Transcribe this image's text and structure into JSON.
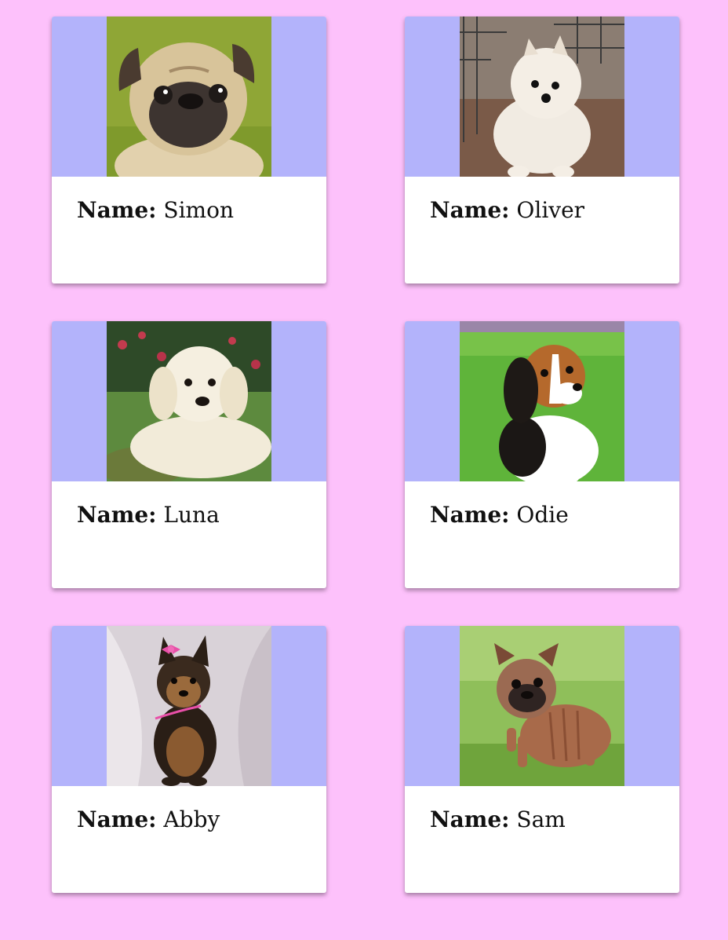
{
  "page": {
    "background": "#fdc1fb",
    "image_band_color": "#b3b3fb"
  },
  "card_label": "Name:",
  "dogs": [
    {
      "name": "Simon",
      "photo": "pug-photo"
    },
    {
      "name": "Oliver",
      "photo": "pomeranian-photo"
    },
    {
      "name": "Luna",
      "photo": "golden-retriever-photo"
    },
    {
      "name": "Odie",
      "photo": "beagle-photo"
    },
    {
      "name": "Abby",
      "photo": "yorkie-photo"
    },
    {
      "name": "Sam",
      "photo": "french-bulldog-photo"
    }
  ]
}
